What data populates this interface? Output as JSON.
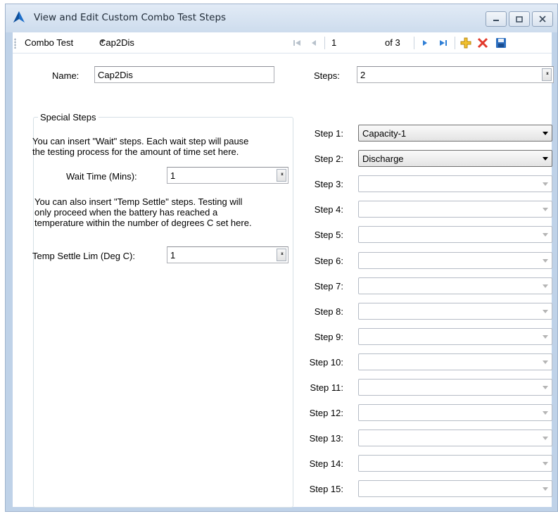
{
  "window": {
    "title": "View and Edit Custom Combo Test Steps",
    "accent": "#1e6fc9"
  },
  "toolbar": {
    "label": "Combo Test",
    "selected_test": "Cap2Dis",
    "position": "1",
    "of_total": "of 3"
  },
  "form": {
    "name_label": "Name:",
    "name_value": "Cap2Dis",
    "steps_label": "Steps:",
    "steps_value": "2"
  },
  "special": {
    "title": "Special Steps",
    "wait_desc_1": "You can insert \"Wait\" steps. Each wait step will pause",
    "wait_desc_2": "the testing process for the amount of time set here.",
    "wait_label": "Wait Time (Mins):",
    "wait_value": "1",
    "temp_desc_1": "You can also insert \"Temp Settle\" steps. Testing will",
    "temp_desc_2": "only proceed when the battery has reached a",
    "temp_desc_3": "temperature within the number of degrees C set here.",
    "temp_label": "Temp Settle Lim (Deg C):",
    "temp_value": "1"
  },
  "steps": [
    {
      "label": "Step 1:",
      "value": "Capacity-1",
      "enabled": true
    },
    {
      "label": "Step 2:",
      "value": "Discharge",
      "enabled": true
    },
    {
      "label": "Step 3:",
      "value": "",
      "enabled": false
    },
    {
      "label": "Step 4:",
      "value": "",
      "enabled": false
    },
    {
      "label": "Step 5:",
      "value": "",
      "enabled": false
    },
    {
      "label": "Step 6:",
      "value": "",
      "enabled": false
    },
    {
      "label": "Step 7:",
      "value": "",
      "enabled": false
    },
    {
      "label": "Step 8:",
      "value": "",
      "enabled": false
    },
    {
      "label": "Step 9:",
      "value": "",
      "enabled": false
    },
    {
      "label": "Step 10:",
      "value": "",
      "enabled": false
    },
    {
      "label": "Step 11:",
      "value": "",
      "enabled": false
    },
    {
      "label": "Step 12:",
      "value": "",
      "enabled": false
    },
    {
      "label": "Step 13:",
      "value": "",
      "enabled": false
    },
    {
      "label": "Step 14:",
      "value": "",
      "enabled": false
    },
    {
      "label": "Step 15:",
      "value": "",
      "enabled": false
    }
  ]
}
